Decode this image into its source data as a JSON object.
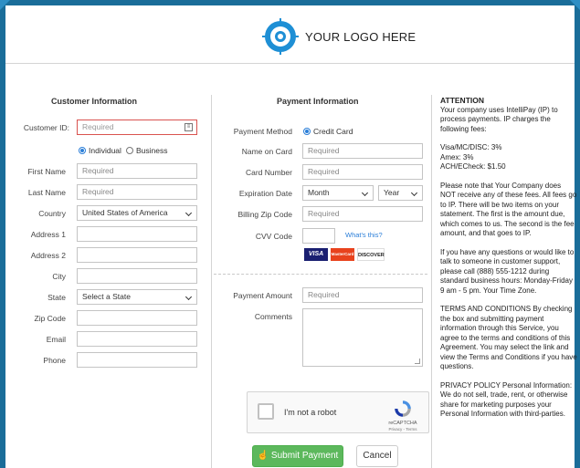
{
  "header": {
    "logo_text": "YOUR LOGO HERE"
  },
  "customer": {
    "title": "Customer Information",
    "customer_id_label": "Customer ID:",
    "customer_id_placeholder": "Required",
    "type_individual": "Individual",
    "type_business": "Business",
    "first_name_label": "First Name",
    "first_name_placeholder": "Required",
    "last_name_label": "Last Name",
    "last_name_placeholder": "Required",
    "country_label": "Country",
    "country_value": "United States of America",
    "address1_label": "Address 1",
    "address2_label": "Address 2",
    "city_label": "City",
    "state_label": "State",
    "state_value": "Select a State",
    "zip_label": "Zip Code",
    "email_label": "Email",
    "phone_label": "Phone"
  },
  "payment": {
    "title": "Payment Information",
    "method_label": "Payment Method",
    "method_value": "Credit Card",
    "name_label": "Name on Card",
    "name_placeholder": "Required",
    "number_label": "Card Number",
    "number_placeholder": "Required",
    "exp_label": "Expiration Date",
    "exp_month": "Month",
    "exp_year": "Year",
    "zip_label": "Billing Zip Code",
    "zip_placeholder": "Required",
    "cvv_label": "CVV Code",
    "cvv_help": "What's this?",
    "cards": [
      "VISA",
      "MasterCard",
      "DISCOVER"
    ],
    "amount_label": "Payment Amount",
    "amount_placeholder": "Required",
    "comments_label": "Comments"
  },
  "recaptcha": {
    "label": "I'm not a robot",
    "brand": "reCAPTCHA",
    "terms": "Privacy - Terms"
  },
  "actions": {
    "submit": "Submit Payment",
    "cancel": "Cancel"
  },
  "attention": {
    "title": "ATTENTION",
    "intro": "Your company uses IntelliPay (IP) to process payments. IP charges the following fees:",
    "fee1": "Visa/MC/DISC:  3%",
    "fee2": "Amex: 3%",
    "fee3": "ACH/ECheck: $1.50",
    "note": "Please note that Your Company does NOT receive any of these fees.  All fees go to IP. There will be two items on your statement. The first is the amount due, which comes to us.  The second is the fee amount, and that goes to IP.",
    "questions": "If you have any questions or would like to talk to someone in customer support, please call (888) 555-1212 during standard business hours: Monday-Friday 9 am - 5 pm. Your Time Zone.",
    "terms": "TERMS AND CONDITIONS By checking the box and submitting payment information through this Service, you agree to the terms and conditions of this Agreement. You may select the link and view the Terms and Conditions if you have questions.",
    "privacy": "PRIVACY POLICY Personal Information: We do not sell, trade, rent, or otherwise share for marketing purposes your Personal Information with third-parties."
  },
  "colors": {
    "frame": "#1a6d99",
    "accent": "#1e8fd5",
    "submit": "#5cb85c",
    "error": "#d9534f",
    "link": "#2a7ed8"
  }
}
